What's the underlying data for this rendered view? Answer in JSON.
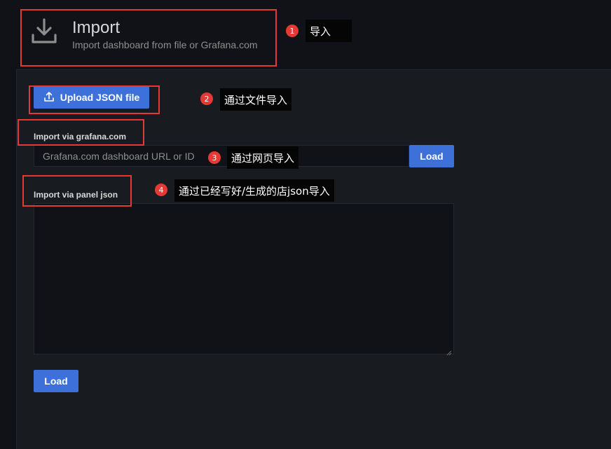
{
  "header": {
    "icon": "download-icon",
    "title": "Import",
    "subtitle": "Import dashboard from file or Grafana.com"
  },
  "upload": {
    "icon": "upload-icon",
    "label": "Upload JSON file"
  },
  "grafana_import": {
    "label": "Import via grafana.com",
    "placeholder": "Grafana.com dashboard URL or ID",
    "load_label": "Load"
  },
  "panel_json": {
    "label": "Import via panel json",
    "value": "",
    "load_label": "Load"
  },
  "annotations": [
    {
      "number": "1",
      "text": "导入"
    },
    {
      "number": "2",
      "text": "通过文件导入"
    },
    {
      "number": "3",
      "text": "通过网页导入"
    },
    {
      "number": "4",
      "text": "通过已经写好/生成的店json导入"
    }
  ],
  "colors": {
    "primary": "#3d71d9",
    "annotation_red": "#e53935",
    "background": "#111217",
    "panel": "#181b1f"
  }
}
